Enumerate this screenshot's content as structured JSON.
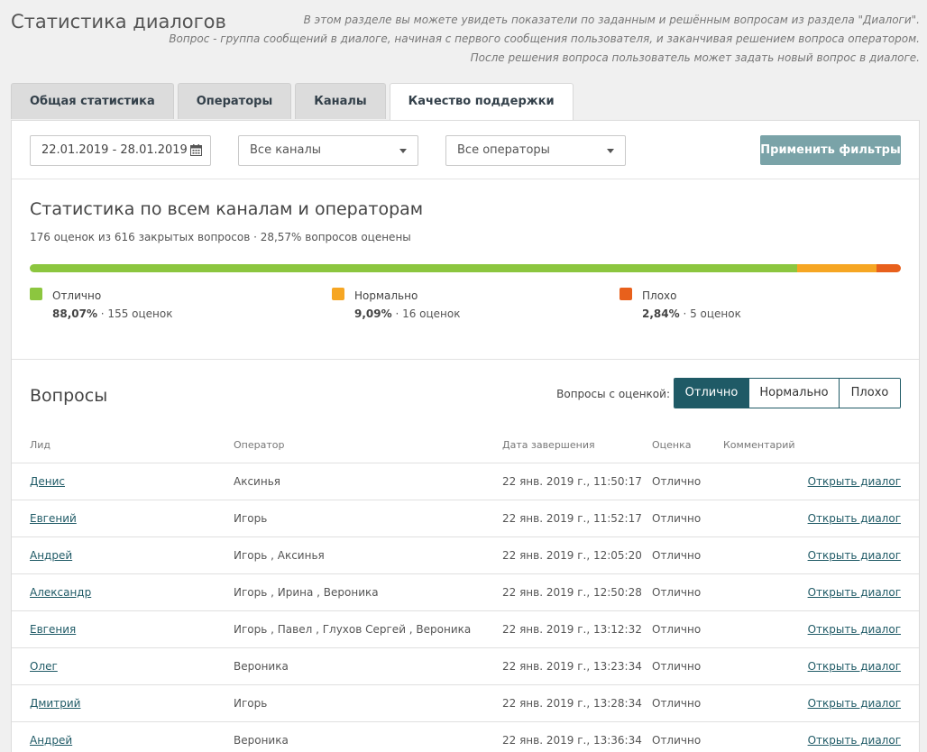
{
  "page": {
    "title": "Статистика диалогов",
    "description": [
      "В этом разделе вы можете увидеть показатели по заданным и решённым вопросам из раздела \"Диалоги\".",
      "Вопрос - группа сообщений в диалоге, начиная с первого сообщения пользователя, и заканчивая решением вопроса оператором.",
      "После решения вопроса пользователь может задать новый вопрос в диалоге."
    ]
  },
  "tabs": [
    {
      "label": "Общая статистика",
      "active": false
    },
    {
      "label": "Операторы",
      "active": false
    },
    {
      "label": "Каналы",
      "active": false
    },
    {
      "label": "Качество поддержки",
      "active": true
    }
  ],
  "filters": {
    "date_range": "22.01.2019 - 28.01.2019",
    "channels": "Все каналы",
    "operators": "Все операторы",
    "apply_label": "Применить фильтры"
  },
  "stats": {
    "title": "Статистика по всем каналам и операторам",
    "subtitle": "176 оценок из 616 закрытых вопросов · 28,57% вопросов оценены",
    "ratings": [
      {
        "label": "Отлично",
        "percent": "88,07%",
        "count": " · 155 оценок",
        "share": 88.07,
        "color": "#8cc63f"
      },
      {
        "label": "Нормально",
        "percent": "9,09%",
        "count": " · 16 оценок",
        "share": 9.09,
        "color": "#f6a623"
      },
      {
        "label": "Плохо",
        "percent": "2,84%",
        "count": " · 5 оценок",
        "share": 2.84,
        "color": "#e8601c"
      }
    ]
  },
  "questions": {
    "title": "Вопросы",
    "filter_label": "Вопросы с оценкой:",
    "filter_options": [
      {
        "label": "Отлично",
        "active": true
      },
      {
        "label": "Нормально",
        "active": false
      },
      {
        "label": "Плохо",
        "active": false
      }
    ],
    "columns": {
      "lead": "Лид",
      "operator": "Оператор",
      "date": "Дата завершения",
      "rating": "Оценка",
      "comment": "Комментарий"
    },
    "open_label": "Открыть диалог",
    "rows": [
      {
        "lead": "Денис",
        "operator": "Аксинья",
        "date": "22 янв. 2019 г., 11:50:17",
        "rating": "Отлично",
        "comment": ""
      },
      {
        "lead": "Евгений",
        "operator": "Игорь",
        "date": "22 янв. 2019 г., 11:52:17",
        "rating": "Отлично",
        "comment": ""
      },
      {
        "lead": "Андрей",
        "operator": "Игорь , Аксинья",
        "date": "22 янв. 2019 г., 12:05:20",
        "rating": "Отлично",
        "comment": ""
      },
      {
        "lead": "Александр",
        "operator": "Игорь , Ирина , Вероника",
        "date": "22 янв. 2019 г., 12:50:28",
        "rating": "Отлично",
        "comment": ""
      },
      {
        "lead": "Евгения",
        "operator": "Игорь , Павел , Глухов Сергей , Вероника",
        "date": "22 янв. 2019 г., 13:12:32",
        "rating": "Отлично",
        "comment": ""
      },
      {
        "lead": "Олег",
        "operator": "Вероника",
        "date": "22 янв. 2019 г., 13:23:34",
        "rating": "Отлично",
        "comment": ""
      },
      {
        "lead": "Дмитрий",
        "operator": "Игорь",
        "date": "22 янв. 2019 г., 13:28:34",
        "rating": "Отлично",
        "comment": ""
      },
      {
        "lead": "Андрей",
        "operator": "Вероника",
        "date": "22 янв. 2019 г., 13:36:34",
        "rating": "Отлично",
        "comment": ""
      }
    ]
  }
}
